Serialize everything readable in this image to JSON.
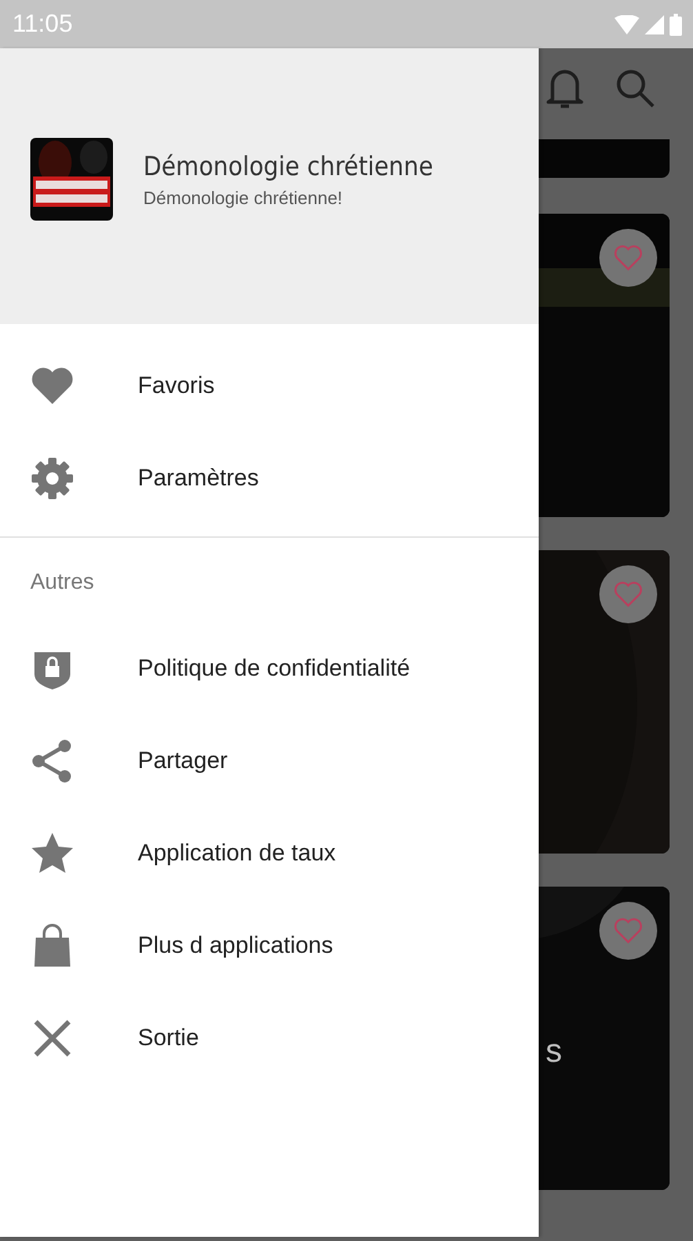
{
  "status_bar": {
    "time": "11:05"
  },
  "drawer": {
    "header": {
      "title": "Démonologie chrétienne",
      "subtitle": "Démonologie chrétienne!"
    },
    "main_items": [
      {
        "kind": "favorites",
        "label": "Favoris"
      },
      {
        "kind": "settings",
        "label": "Paramètres"
      }
    ],
    "section_label": "Autres",
    "other_items": [
      {
        "kind": "privacy",
        "label": "Politique de confidentialité"
      },
      {
        "kind": "share",
        "label": "Partager"
      },
      {
        "kind": "rate",
        "label": "Application de taux"
      },
      {
        "kind": "more",
        "label": "Plus d applications"
      },
      {
        "kind": "exit",
        "label": "Sortie"
      }
    ]
  },
  "background": {
    "cards": [
      {
        "kind": "partial"
      },
      {
        "kind": "card",
        "favorite": false
      },
      {
        "kind": "card",
        "favorite": false
      },
      {
        "kind": "card",
        "favorite": false,
        "caption": "s"
      }
    ]
  }
}
